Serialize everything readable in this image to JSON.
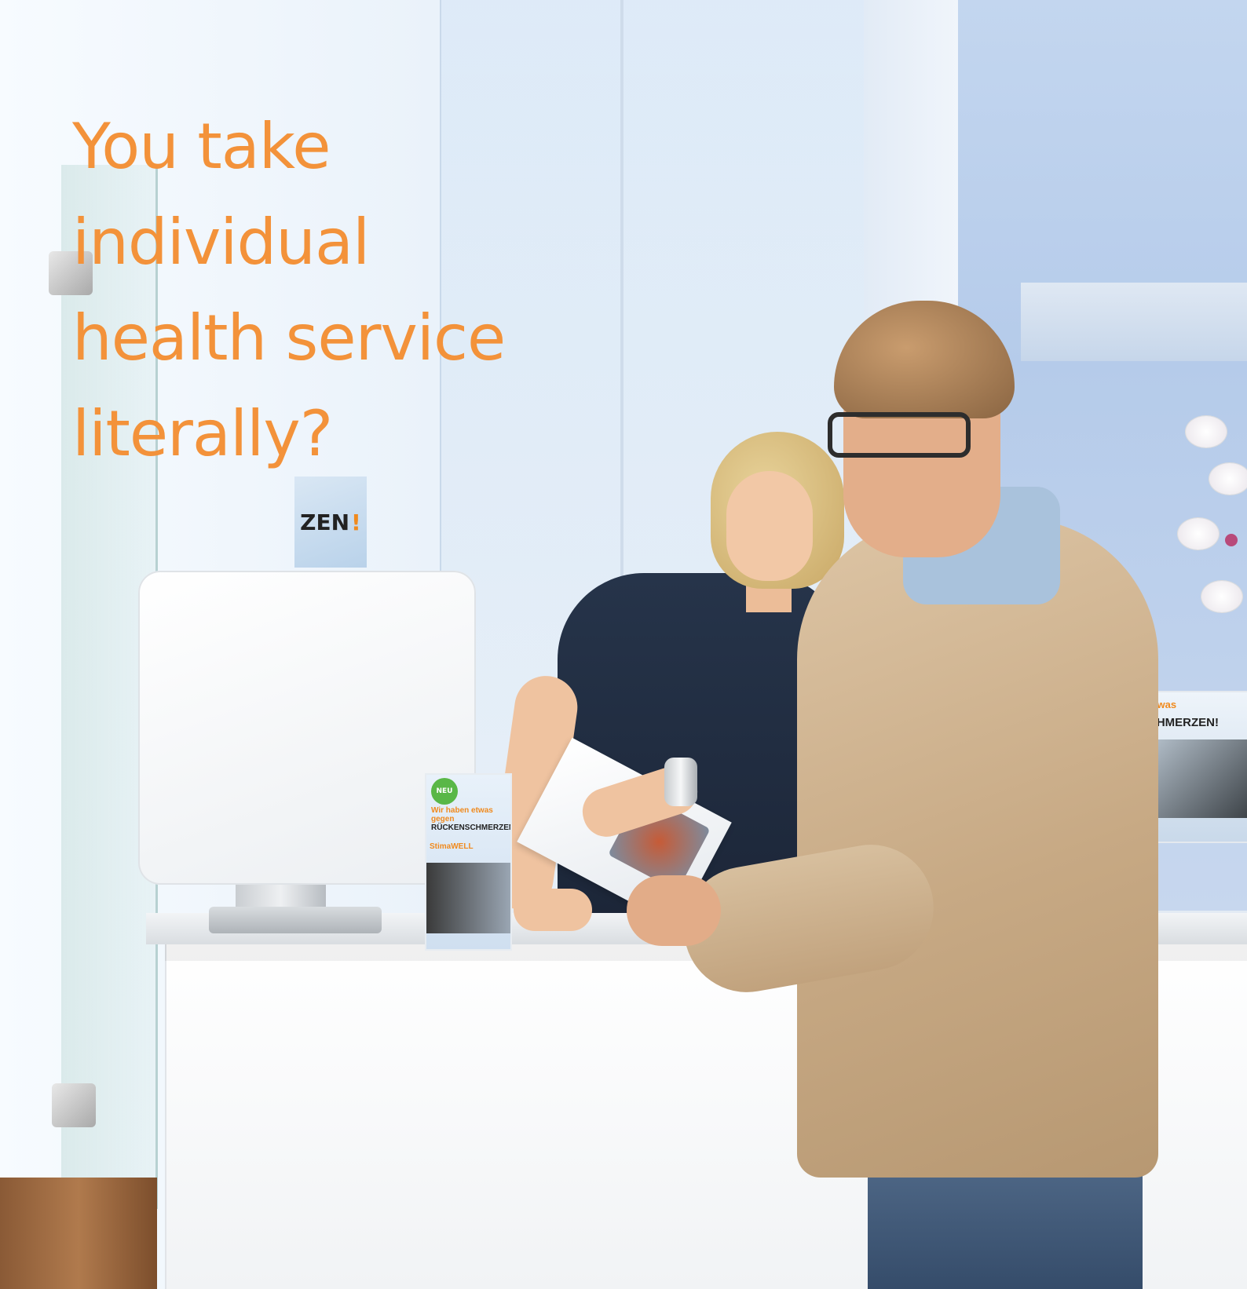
{
  "headline": {
    "lines": [
      "You take",
      "individual",
      "health service",
      "literally?"
    ],
    "color": "#f3923a"
  },
  "background_sign": {
    "text": "ZEN",
    "mark": "!"
  },
  "flyer": {
    "badge": "NEU",
    "line1": "Wir haben etwas",
    "line2": "gegen",
    "headline_plain": "RÜCKEN",
    "headline_bold": "SCHMERZEN",
    "mark": "!",
    "brand": "StimaWELL"
  },
  "poster_right": {
    "line1": "etwas",
    "line2": "CHMERZEN!"
  },
  "colors": {
    "accent_orange": "#f08a1e",
    "jacket": "#c7a984",
    "woman_top": "#1c2638"
  }
}
